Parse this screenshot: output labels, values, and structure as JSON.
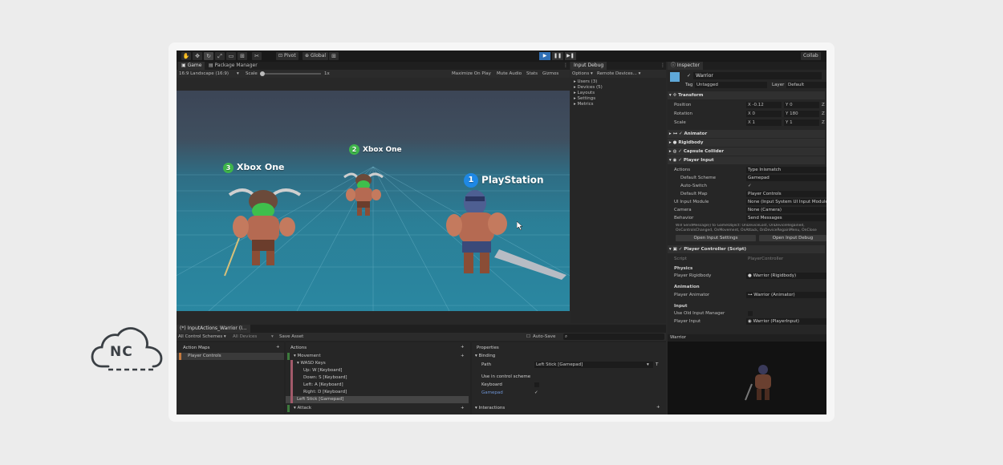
{
  "brand": {
    "logo_text": "NC"
  },
  "toolbar": {
    "pivot_label": "Pivot",
    "global_label": "Global",
    "collab_label": "Collab"
  },
  "game_panel": {
    "tabs": [
      {
        "label": "Game"
      },
      {
        "label": "Package Manager"
      }
    ],
    "aspect": "16:9 Landscape (16:9)",
    "scale_label": "Scale",
    "scale_value": "1x",
    "options": [
      "Maximize On Play",
      "Mute Audio",
      "Stats",
      "Gizmos"
    ]
  },
  "players": [
    {
      "num": "3",
      "label": "Xbox One"
    },
    {
      "num": "2",
      "label": "Xbox One"
    },
    {
      "num": "1",
      "label": "PlayStation"
    }
  ],
  "input_debug": {
    "tab": "Input Debug",
    "options": "Options ▾",
    "remote": "Remote Devices... ▾",
    "items": [
      "Users (3)",
      "Devices (5)",
      "Layouts",
      "Settings",
      "Metrics"
    ]
  },
  "inspector": {
    "tab": "Inspector",
    "object_name": "Warrior",
    "tag_label": "Tag",
    "tag_value": "Untagged",
    "layer_label": "Layer",
    "layer_value": "Default",
    "transform": {
      "title": "Transform",
      "rows": [
        {
          "label": "Position",
          "x": "-0.12",
          "y": "0",
          "z": "Z"
        },
        {
          "label": "Rotation",
          "x": "0",
          "y": "180",
          "z": "Z"
        },
        {
          "label": "Scale",
          "x": "1",
          "y": "1",
          "z": "Z"
        }
      ]
    },
    "components": [
      "Animator",
      "Rigidbody",
      "Capsule Collider"
    ],
    "player_input": {
      "title": "Player Input",
      "rows": [
        {
          "label": "Actions",
          "value": "Type Inismatch"
        },
        {
          "label": "Default Scheme",
          "value": "Gamepad"
        },
        {
          "label": "Auto-Switch",
          "value": "✓"
        },
        {
          "label": "Default Map",
          "value": "Player Controls"
        },
        {
          "label": "UI Input Module",
          "value": "None (Input System UI Input Module)"
        },
        {
          "label": "Camera",
          "value": "None (Camera)"
        },
        {
          "label": "Behavior",
          "value": "Send Messages"
        }
      ],
      "note1": "Will SendMessage() to GameObject: OnDeviceLost, OnDeviceRegained,",
      "note2": "OnControlsChanged, OnMovement, OnAttack, OnDeviceRegainMenu, OnClose",
      "btn_settings": "Open Input Settings",
      "btn_debug": "Open Input Debug"
    },
    "player_controller": {
      "title": "Player Controller (Script)",
      "script_label": "Script",
      "script_value": "PlayerController",
      "physics": "Physics",
      "rigidbody_label": "Player Rigidbody",
      "rigidbody_value": "Warrior (Rigidbody)",
      "animation": "Animation",
      "animator_label": "Player Animator",
      "animator_value": "Warrior (Animator)",
      "input": "Input",
      "old_input_label": "Use Old Input Manager",
      "player_input_label": "Player Input",
      "player_input_value": "Warrior (PlayerInput)"
    },
    "preview_title": "Warrior"
  },
  "input_actions": {
    "tab": "(*) InputActions_Warrior (I...",
    "control_schemes": "All Control Schemes ▾",
    "devices": "All Devices",
    "save": "Save Asset",
    "autosave": "Auto-Save",
    "maps_header": "Action Maps",
    "maps": [
      "Player Controls"
    ],
    "actions_header": "Actions",
    "actions": [
      {
        "label": "▾ Movement",
        "indent": 0
      },
      {
        "label": "▾ WASD Keys",
        "indent": 1
      },
      {
        "label": "Up: W [Keyboard]",
        "indent": 2
      },
      {
        "label": "Down: S [Keyboard]",
        "indent": 2
      },
      {
        "label": "Left: A [Keyboard]",
        "indent": 2
      },
      {
        "label": "Right: D [Keyboard]",
        "indent": 2
      },
      {
        "label": "Left Stick [Gamepad]",
        "indent": 1,
        "selected": true
      },
      {
        "label": "▾ Attack",
        "indent": 0
      }
    ],
    "props_header": "Properties",
    "binding": "▾ Binding",
    "path_label": "Path",
    "path_value": "Left Stick [Gamepad]",
    "use_in_scheme": "Use in control scheme",
    "keyboard": "Keyboard",
    "gamepad": "Gamepad",
    "interactions": "▾ Interactions"
  },
  "colors": {
    "accent": "#3a7bd5",
    "green": "#3eb54a",
    "blue": "#1e88e5"
  }
}
